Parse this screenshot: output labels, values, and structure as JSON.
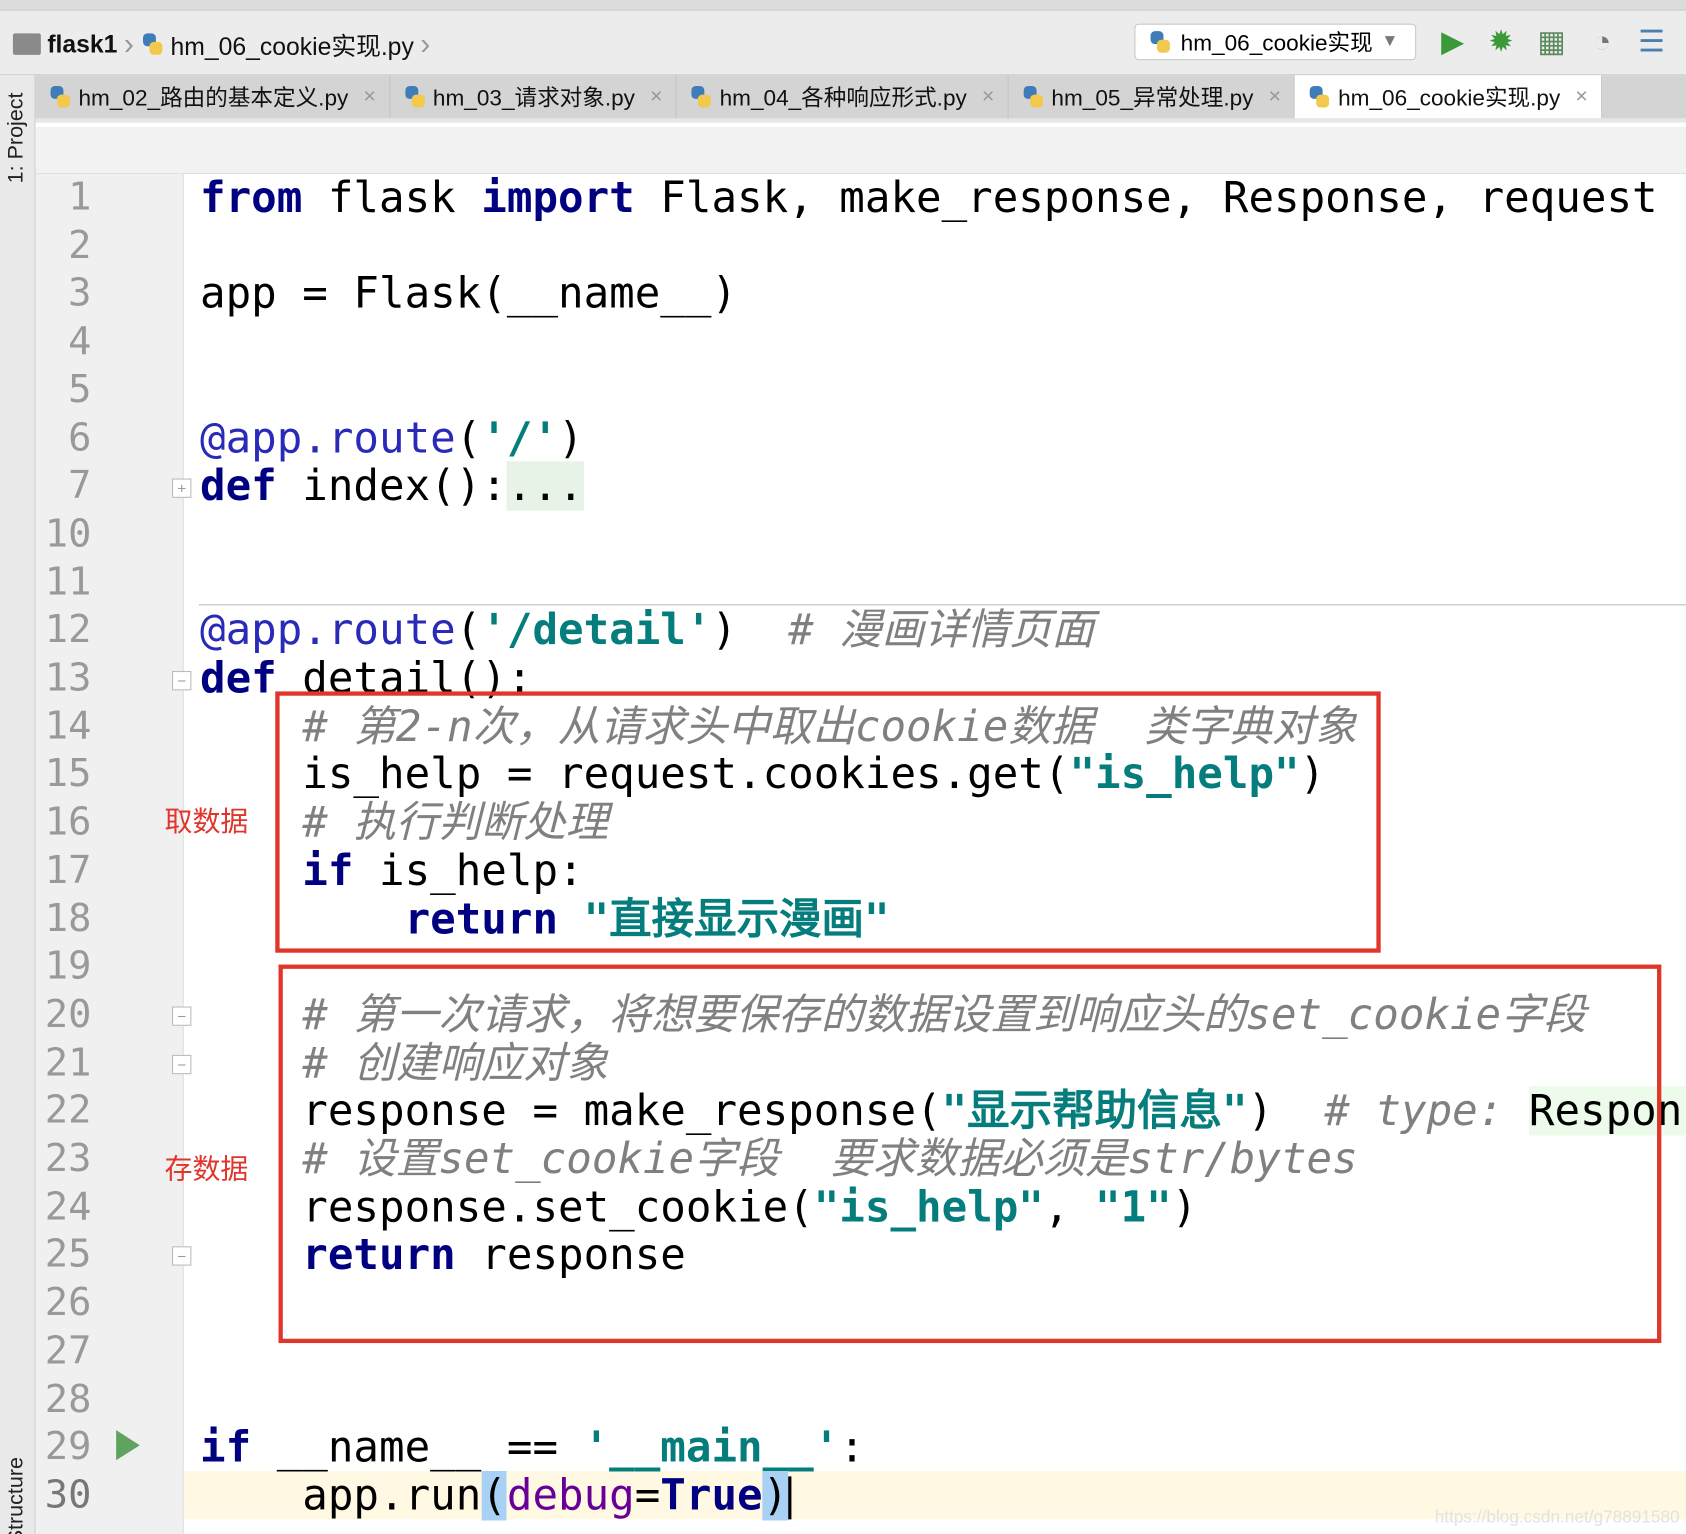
{
  "breadcrumb": {
    "project": "flask1",
    "file": "hm_06_cookie实现.py"
  },
  "run_config": {
    "label": "hm_06_cookie实现"
  },
  "toolbar": {
    "icons": [
      "run-icon",
      "debug-icon",
      "coverage-icon",
      "profile-icon",
      "build-icon"
    ],
    "accent": "#3a9a3a"
  },
  "tabs": [
    {
      "label": "hm_02_路由的基本定义.py",
      "active": false
    },
    {
      "label": "hm_03_请求对象.py",
      "active": false
    },
    {
      "label": "hm_04_各种响应形式.py",
      "active": false
    },
    {
      "label": "hm_05_异常处理.py",
      "active": false
    },
    {
      "label": "hm_06_cookie实现.py",
      "active": true
    }
  ],
  "tab_close": "×",
  "side": {
    "project": "1: Project",
    "structure": "Structure"
  },
  "annotations": {
    "get_data": "取数据",
    "set_data": "存数据",
    "box_color": "#e0352b"
  },
  "watermark": "https://blog.csdn.net/g78891580",
  "lines": [
    {
      "n": "1",
      "t": [
        [
          "kw",
          "from"
        ],
        [
          "",
          "·flask·"
        ],
        [
          "kw",
          "import"
        ],
        [
          "",
          "·Flask,·make_response,·Response,·request"
        ]
      ]
    },
    {
      "n": "2",
      "t": []
    },
    {
      "n": "3",
      "t": [
        [
          "",
          "app·=·Flask(__name__)"
        ]
      ]
    },
    {
      "n": "4",
      "t": []
    },
    {
      "n": "5",
      "t": []
    },
    {
      "n": "6",
      "t": [
        [
          "dec",
          "@app.route"
        ],
        [
          "",
          "("
        ],
        [
          "str",
          "'/'"
        ],
        [
          "",
          ")"
        ]
      ]
    },
    {
      "n": "7",
      "t": [
        [
          "kw",
          "def"
        ],
        [
          "",
          "·index():"
        ],
        [
          "fold",
          "..."
        ]
      ]
    },
    {
      "n": "10",
      "t": []
    },
    {
      "n": "11",
      "t": []
    },
    {
      "n": "12",
      "t": [
        [
          "dec",
          "@app.route"
        ],
        [
          "",
          "("
        ],
        [
          "str",
          "'/detail'"
        ],
        [
          "",
          ")··"
        ],
        [
          "cm",
          "#·漫画详情页面"
        ]
      ]
    },
    {
      "n": "13",
      "t": [
        [
          "kw",
          "def"
        ],
        [
          "",
          "·detail():"
        ]
      ]
    },
    {
      "n": "14",
      "t": [
        [
          "",
          "    "
        ],
        [
          "cm",
          "#·第2-n次，从请求头中取出cookie数据··类字典对象"
        ]
      ]
    },
    {
      "n": "15",
      "t": [
        [
          "",
          "    is_help·=·request.cookies.get("
        ],
        [
          "str",
          "\"is_help\""
        ],
        [
          "",
          ")"
        ]
      ]
    },
    {
      "n": "16",
      "t": [
        [
          "",
          "    "
        ],
        [
          "cm",
          "#·执行判断处理"
        ]
      ]
    },
    {
      "n": "17",
      "t": [
        [
          "",
          "    "
        ],
        [
          "kw",
          "if"
        ],
        [
          "",
          "·is_help:"
        ]
      ]
    },
    {
      "n": "18",
      "t": [
        [
          "",
          "        "
        ],
        [
          "kw",
          "return"
        ],
        [
          "",
          "·"
        ],
        [
          "str",
          "\"直接显示漫画\""
        ]
      ]
    },
    {
      "n": "19",
      "t": []
    },
    {
      "n": "20",
      "t": [
        [
          "",
          "    "
        ],
        [
          "cm",
          "#·第一次请求，将想要保存的数据设置到响应头的set_cookie字段"
        ]
      ]
    },
    {
      "n": "21",
      "t": [
        [
          "",
          "    "
        ],
        [
          "cm",
          "#·创建响应对象"
        ]
      ]
    },
    {
      "n": "22",
      "t": [
        [
          "",
          "    response·=·make_response("
        ],
        [
          "str",
          "\"显示帮助信息\""
        ],
        [
          "",
          ")··"
        ],
        [
          "cm",
          "#·type:·"
        ],
        [
          "typ",
          "Response"
        ]
      ]
    },
    {
      "n": "23",
      "t": [
        [
          "",
          "    "
        ],
        [
          "cm",
          "#·设置set_cookie字段··要求数据必须是str/bytes"
        ]
      ]
    },
    {
      "n": "24",
      "t": [
        [
          "",
          "    response.set_cookie("
        ],
        [
          "str",
          "\"is_help\""
        ],
        [
          "",
          ",·"
        ],
        [
          "str",
          "\"1\""
        ],
        [
          "",
          ")"
        ]
      ]
    },
    {
      "n": "25",
      "t": [
        [
          "",
          "    "
        ],
        [
          "kw",
          "return"
        ],
        [
          "",
          "·response"
        ]
      ]
    },
    {
      "n": "26",
      "t": []
    },
    {
      "n": "27",
      "t": []
    },
    {
      "n": "28",
      "t": []
    },
    {
      "n": "29",
      "t": [
        [
          "kw",
          "if"
        ],
        [
          "",
          "·__name__·==·"
        ],
        [
          "str",
          "'__main__'"
        ],
        [
          "",
          ":"
        ]
      ]
    },
    {
      "n": "30",
      "t": [
        [
          "",
          "    app.run"
        ],
        [
          "bracket",
          "("
        ],
        [
          "param",
          "debug"
        ],
        [
          "",
          "="
        ],
        [
          "kw",
          "True"
        ],
        [
          "bracket",
          ")"
        ]
      ]
    }
  ]
}
